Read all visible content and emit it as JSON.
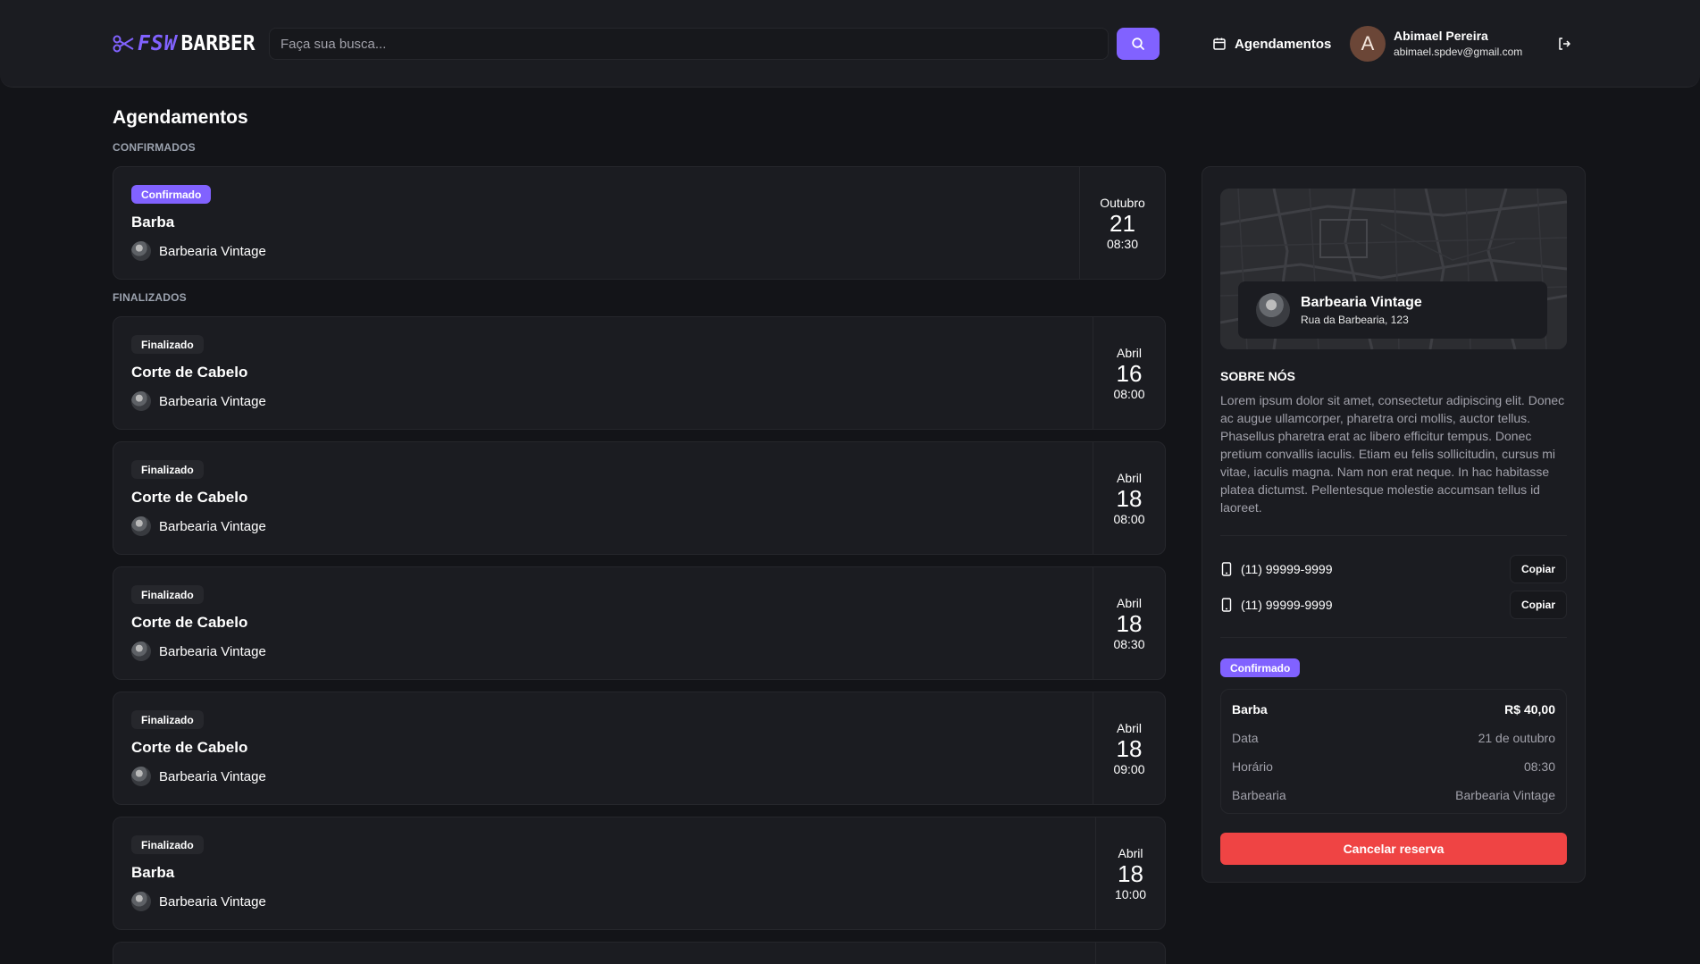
{
  "header": {
    "logo_prefix": "FSW",
    "logo_name": "BARBER",
    "search_placeholder": "Faça sua busca...",
    "nav_appointments": "Agendamentos",
    "user_initial": "A",
    "user_name": "Abimael Pereira",
    "user_email": "abimael.spdev@gmail.com"
  },
  "page": {
    "title": "Agendamentos",
    "confirmed_label": "CONFIRMADOS",
    "finished_label": "FINALIZADOS"
  },
  "confirmed": [
    {
      "status": "Confirmado",
      "service": "Barba",
      "shop": "Barbearia Vintage",
      "month": "Outubro",
      "day": "21",
      "time": "08:30"
    }
  ],
  "finished": [
    {
      "status": "Finalizado",
      "service": "Corte de Cabelo",
      "shop": "Barbearia Vintage",
      "month": "Abril",
      "day": "16",
      "time": "08:00"
    },
    {
      "status": "Finalizado",
      "service": "Corte de Cabelo",
      "shop": "Barbearia Vintage",
      "month": "Abril",
      "day": "18",
      "time": "08:00"
    },
    {
      "status": "Finalizado",
      "service": "Corte de Cabelo",
      "shop": "Barbearia Vintage",
      "month": "Abril",
      "day": "18",
      "time": "08:30"
    },
    {
      "status": "Finalizado",
      "service": "Corte de Cabelo",
      "shop": "Barbearia Vintage",
      "month": "Abril",
      "day": "18",
      "time": "09:00"
    },
    {
      "status": "Finalizado",
      "service": "Barba",
      "shop": "Barbearia Vintage",
      "month": "Abril",
      "day": "18",
      "time": "10:00"
    }
  ],
  "side": {
    "shop_name": "Barbearia Vintage",
    "shop_address": "Rua da Barbearia, 123",
    "about_title": "SOBRE NÓS",
    "about_text": "Lorem ipsum dolor sit amet, consectetur adipiscing elit. Donec ac augue ullamcorper, pharetra orci mollis, auctor tellus. Phasellus pharetra erat ac libero efficitur tempus. Donec pretium convallis iaculis. Etiam eu felis sollicitudin, cursus mi vitae, iaculis magna. Nam non erat neque. In hac habitasse platea dictumst. Pellentesque molestie accumsan tellus id laoreet.",
    "phones": [
      "(11) 99999-9999",
      "(11) 99999-9999"
    ],
    "copy_label": "Copiar",
    "status": "Confirmado",
    "summary": {
      "service": "Barba",
      "price": "R$ 40,00",
      "date_label": "Data",
      "date_value": "21 de outubro",
      "time_label": "Horário",
      "time_value": "08:30",
      "shop_label": "Barbearia",
      "shop_value": "Barbearia Vintage"
    },
    "cancel_label": "Cancelar reserva"
  },
  "colors": {
    "accent": "#8162ff",
    "danger": "#ef4444",
    "background": "#131418",
    "card": "#1b1c21"
  },
  "icons": [
    "scissors-icon",
    "search-icon",
    "calendar-icon",
    "logout-icon",
    "smartphone-icon"
  ]
}
